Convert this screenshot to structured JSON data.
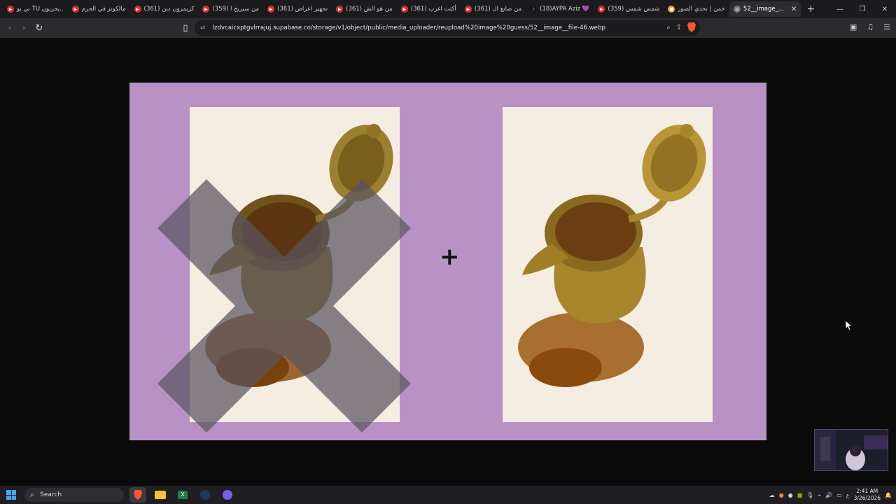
{
  "tabs": [
    {
      "label": "تي يو TU يجربون..",
      "color": "#e02d2d",
      "active": false
    },
    {
      "label": "مالكونز في الحرم",
      "color": "#e02d2d",
      "active": false
    },
    {
      "label": "(361) كريمزون دين",
      "color": "#e02d2d",
      "active": false
    },
    {
      "label": "(359) من سيربح ا",
      "color": "#e02d2d",
      "active": false
    },
    {
      "label": "(361) تجهيز اعراض",
      "color": "#e02d2d",
      "active": false
    },
    {
      "label": "(361) من هو الش",
      "color": "#e02d2d",
      "active": false
    },
    {
      "label": "(361) أكثت اغرب",
      "color": "#e02d2d",
      "active": false
    },
    {
      "label": "(361) من صانع ال",
      "color": "#e02d2d",
      "active": false
    },
    {
      "label": "(18)AYPA Aziz 💜",
      "color": "#111111",
      "active": false
    },
    {
      "label": "(359) شمس شمس",
      "color": "#e02d2d",
      "active": false
    },
    {
      "label": "خمن | تحدي الصور",
      "color": "#f0a030",
      "active": false
    },
    {
      "label": "52__image_...",
      "color": "#888888",
      "active": true
    }
  ],
  "url": "lzdvcaicxptgvlrrajuj.supabase.co/storage/v1/object/public/media_uploader/reupload%20image%20guess/52__image__file-46.webp",
  "taskbar": {
    "search_label": "Search",
    "time": "2:41 AM",
    "date": "3/26/2026",
    "lang": "ع"
  },
  "colors": {
    "canvas_bg": "#b892c4",
    "panel_bg": "#f5ede2",
    "x_mark": "#5a5560"
  },
  "icons": [
    "brave-icon",
    "file-explorer-icon",
    "excel-icon",
    "steam-icon",
    "discord-icon",
    "windows-icon",
    "search-icon"
  ]
}
